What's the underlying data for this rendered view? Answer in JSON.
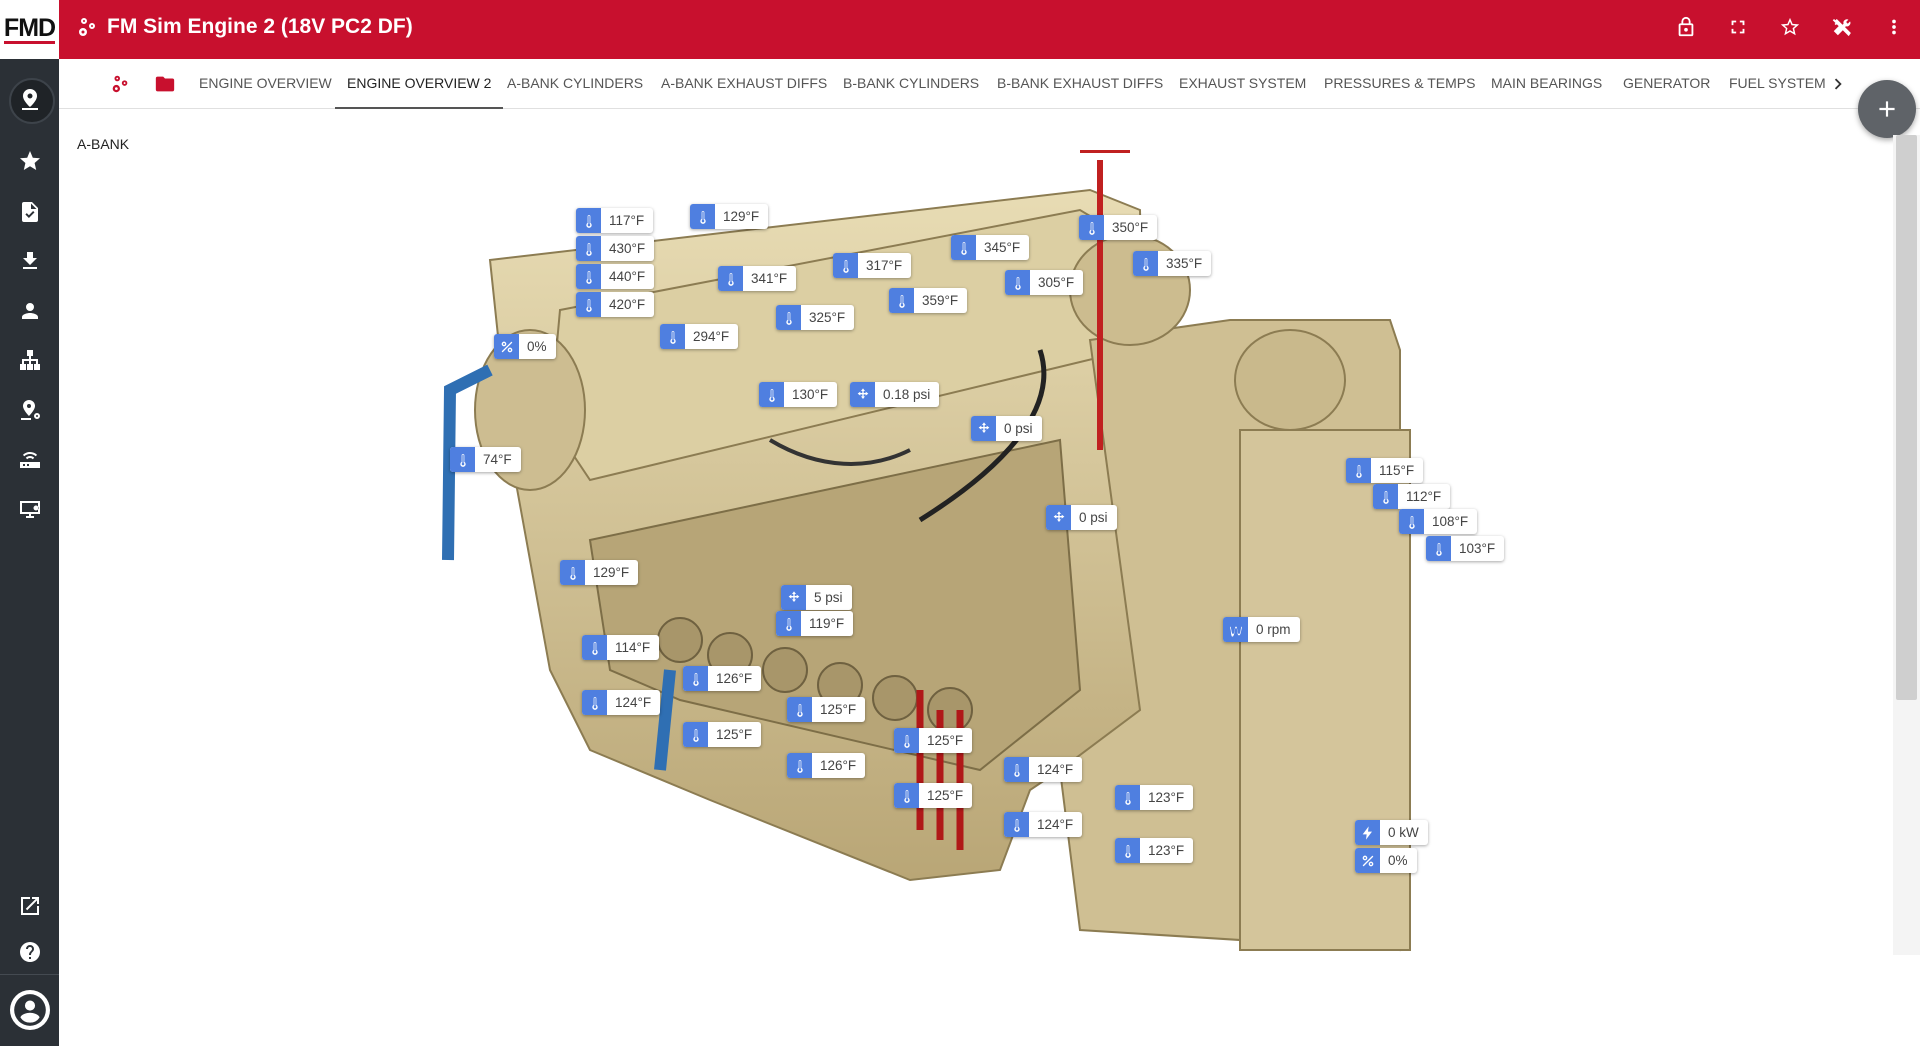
{
  "app": {
    "logo_text": "FMD",
    "title": "FM Sim Engine 2 (18V PC2 DF)",
    "accent_color": "#c8102e",
    "chip_icon_color": "#4f7fe0"
  },
  "rail": {
    "items": [
      {
        "name": "dashboard-icon"
      },
      {
        "name": "favorites-icon"
      },
      {
        "name": "reports-icon"
      },
      {
        "name": "download-icon"
      },
      {
        "name": "user-icon"
      },
      {
        "name": "hierarchy-icon"
      },
      {
        "name": "asset-settings-icon"
      },
      {
        "name": "gateway-icon"
      },
      {
        "name": "display-settings-icon"
      }
    ],
    "bottom": [
      {
        "name": "open-external-icon"
      },
      {
        "name": "help-icon"
      },
      {
        "name": "account-icon"
      }
    ]
  },
  "header_actions": [
    {
      "name": "lock-icon"
    },
    {
      "name": "fullscreen-icon"
    },
    {
      "name": "star-icon"
    },
    {
      "name": "tools-icon"
    },
    {
      "name": "more-vert-icon"
    }
  ],
  "tabs": [
    {
      "label": "ENGINE OVERVIEW"
    },
    {
      "label": "ENGINE OVERVIEW 2",
      "active": true
    },
    {
      "label": "A-BANK CYLINDERS"
    },
    {
      "label": "A-BANK EXHAUST DIFFS"
    },
    {
      "label": "B-BANK CYLINDERS"
    },
    {
      "label": "B-BANK EXHAUST DIFFS"
    },
    {
      "label": "EXHAUST SYSTEM"
    },
    {
      "label": "PRESSURES & TEMPS"
    },
    {
      "label": "MAIN BEARINGS"
    },
    {
      "label": "GENERATOR"
    },
    {
      "label": "FUEL SYSTEM"
    }
  ],
  "section_label": "A-BANK",
  "sensors": [
    {
      "type": "temp",
      "value": "117°F"
    },
    {
      "type": "temp",
      "value": "430°F"
    },
    {
      "type": "temp",
      "value": "440°F"
    },
    {
      "type": "temp",
      "value": "420°F"
    },
    {
      "type": "temp",
      "value": "129°F"
    },
    {
      "type": "temp",
      "value": "341°F"
    },
    {
      "type": "temp",
      "value": "317°F"
    },
    {
      "type": "temp",
      "value": "345°F"
    },
    {
      "type": "temp",
      "value": "350°F"
    },
    {
      "type": "temp",
      "value": "335°F"
    },
    {
      "type": "temp",
      "value": "305°F"
    },
    {
      "type": "temp",
      "value": "359°F"
    },
    {
      "type": "temp",
      "value": "325°F"
    },
    {
      "type": "temp",
      "value": "294°F"
    },
    {
      "type": "percent",
      "value": "0%"
    },
    {
      "type": "temp",
      "value": "130°F"
    },
    {
      "type": "pressure",
      "value": "0.18 psi"
    },
    {
      "type": "pressure",
      "value": "0 psi"
    },
    {
      "type": "temp",
      "value": "74°F"
    },
    {
      "type": "temp",
      "value": "115°F"
    },
    {
      "type": "temp",
      "value": "112°F"
    },
    {
      "type": "temp",
      "value": "108°F"
    },
    {
      "type": "temp",
      "value": "103°F"
    },
    {
      "type": "pressure",
      "value": "0 psi"
    },
    {
      "type": "temp",
      "value": "129°F"
    },
    {
      "type": "pressure",
      "value": "5 psi"
    },
    {
      "type": "temp",
      "value": "119°F"
    },
    {
      "type": "speed",
      "value": "0 rpm"
    },
    {
      "type": "temp",
      "value": "114°F"
    },
    {
      "type": "temp",
      "value": "126°F"
    },
    {
      "type": "temp",
      "value": "124°F"
    },
    {
      "type": "temp",
      "value": "125°F"
    },
    {
      "type": "temp",
      "value": "125°F"
    },
    {
      "type": "temp",
      "value": "125°F"
    },
    {
      "type": "temp",
      "value": "126°F"
    },
    {
      "type": "temp",
      "value": "124°F"
    },
    {
      "type": "temp",
      "value": "125°F"
    },
    {
      "type": "temp",
      "value": "123°F"
    },
    {
      "type": "temp",
      "value": "124°F"
    },
    {
      "type": "temp",
      "value": "123°F"
    },
    {
      "type": "power",
      "value": "0 kW"
    },
    {
      "type": "percent",
      "value": "0%"
    }
  ]
}
